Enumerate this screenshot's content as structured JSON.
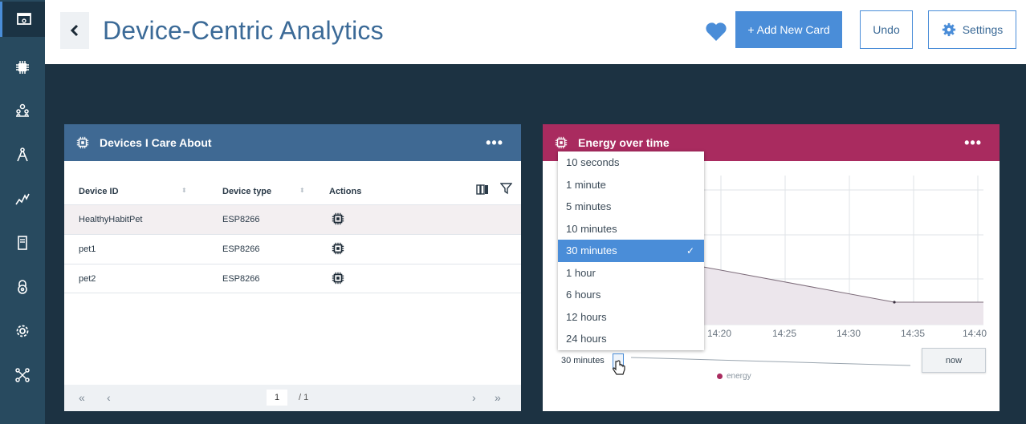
{
  "header": {
    "title": "Device-Centric Analytics",
    "add_card_label": "+ Add New Card",
    "undo_label": "Undo",
    "settings_label": "Settings"
  },
  "nav": {
    "items": [
      "dashboard-icon",
      "chip-icon",
      "members-icon",
      "rules-icon",
      "analytics-icon",
      "devices-icon",
      "security-icon",
      "settings-icon",
      "extensions-icon"
    ]
  },
  "devices_card": {
    "title": "Devices I Care About",
    "columns": [
      "Device ID",
      "Device type",
      "Actions"
    ],
    "rows": [
      {
        "id": "HealthyHabitPet",
        "type": "ESP8266"
      },
      {
        "id": "pet1",
        "type": "ESP8266"
      },
      {
        "id": "pet2",
        "type": "ESP8266"
      }
    ],
    "page": "1",
    "page_of": "/ 1"
  },
  "energy_card": {
    "title": "Energy over time",
    "time_options": [
      "10 seconds",
      "1 minute",
      "5 minutes",
      "10 minutes",
      "30 minutes",
      "1 hour",
      "6 hours",
      "12 hours",
      "24 hours"
    ],
    "selected_option": "30 minutes",
    "now_label": "now",
    "legend_label": "energy",
    "x_ticks": [
      "14:20",
      "14:25",
      "14:30",
      "14:35",
      "14:40"
    ]
  },
  "colors": {
    "nav_bg": "#284a5f",
    "page_bg": "#1c3242",
    "devices_header": "#3f6993",
    "energy_header": "#a92b5f",
    "accent": "#4a8dd8"
  }
}
